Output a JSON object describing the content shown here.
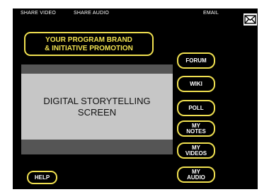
{
  "top_bar": {
    "share_video": "SHARE VIDEO",
    "share_audio": "SHARE AUDIO",
    "email": "EMAIL",
    "email_icon": "envelope-icon"
  },
  "brand": {
    "line1": "YOUR PROGRAM BRAND",
    "line2": "& INITIATIVE PROMOTION"
  },
  "screen": {
    "line1": "DIGITAL STORYTELLING",
    "line2": "SCREEN"
  },
  "nav": {
    "forum": "FORUM",
    "wiki": "WIKI",
    "poll": "POLL",
    "my_notes": [
      "MY",
      "NOTES"
    ],
    "my_videos": [
      "MY",
      "VIDEOS"
    ],
    "my_audio": [
      "MY",
      "AUDIO"
    ]
  },
  "help": "HELP",
  "colors": {
    "background": "#000000",
    "accent": "#f0e050",
    "screen": "#c6c6c6"
  }
}
